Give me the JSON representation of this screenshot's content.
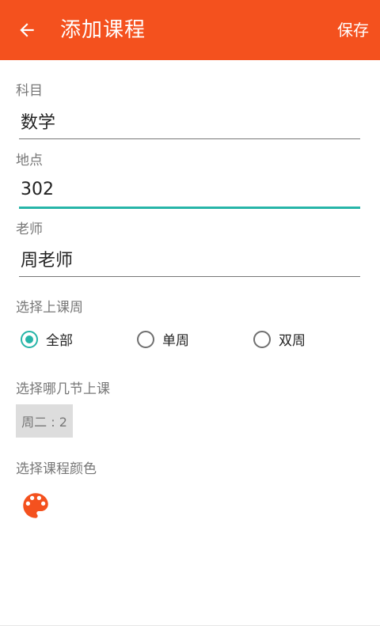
{
  "appbar": {
    "title": "添加课程",
    "save_label": "保存",
    "back_icon": "arrow-left-icon",
    "color": "#f4511e"
  },
  "form": {
    "subject": {
      "label": "科目",
      "value": "数学"
    },
    "location": {
      "label": "地点",
      "value": "302"
    },
    "teacher": {
      "label": "老师",
      "value": "周老师"
    }
  },
  "week_select": {
    "label": "选择上课周",
    "options": [
      "全部",
      "单周",
      "双周"
    ],
    "selected": "全部"
  },
  "period_select": {
    "label": "选择哪几节上课",
    "chip": "周二 : 2"
  },
  "color_select": {
    "label": "选择课程颜色",
    "icon": "palette-icon",
    "color": "#f4511e"
  },
  "accent_color": "#26b5a8"
}
